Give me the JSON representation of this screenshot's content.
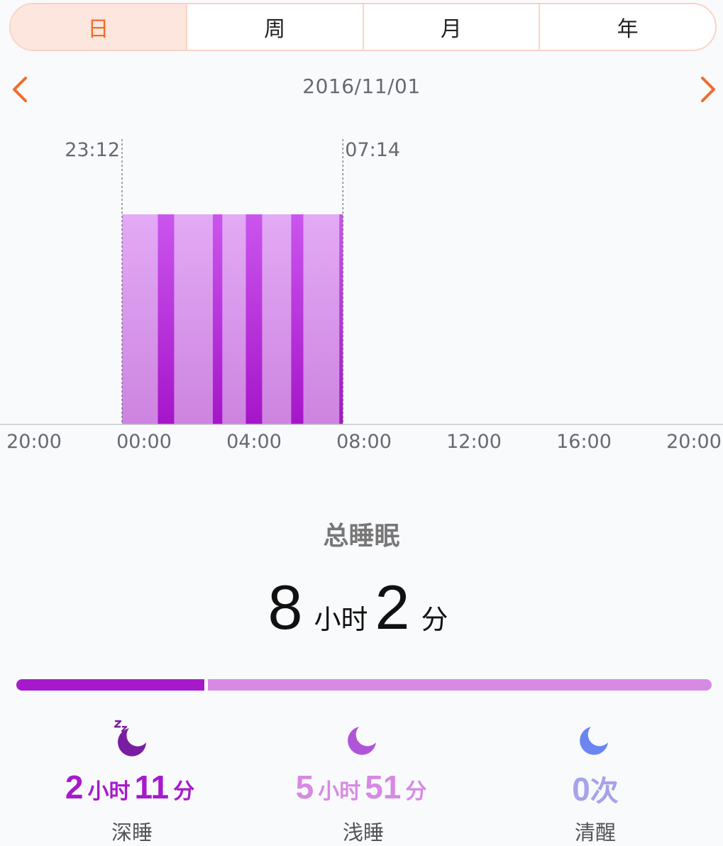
{
  "tabs": [
    "日",
    "周",
    "月",
    "年"
  ],
  "date": "2016/11/01",
  "chart_data": {
    "type": "bar",
    "x_ticks": [
      "20:00",
      "00:00",
      "04:00",
      "08:00",
      "12:00",
      "16:00",
      "20:00"
    ],
    "x_range_hours": [
      -4,
      20
    ],
    "sleep_start_label": "23:12",
    "sleep_end_label": "07:14",
    "sleep_start": -0.8,
    "sleep_end": 7.233,
    "segments": [
      {
        "stage": "light",
        "start": -0.8,
        "end": 0.5
      },
      {
        "stage": "deep",
        "start": 0.5,
        "end": 1.1
      },
      {
        "stage": "light",
        "start": 1.1,
        "end": 2.5
      },
      {
        "stage": "deep",
        "start": 2.5,
        "end": 2.85
      },
      {
        "stage": "light",
        "start": 2.85,
        "end": 3.7
      },
      {
        "stage": "deep",
        "start": 3.7,
        "end": 4.3
      },
      {
        "stage": "light",
        "start": 4.3,
        "end": 5.35
      },
      {
        "stage": "deep",
        "start": 5.35,
        "end": 5.8
      },
      {
        "stage": "light",
        "start": 5.8,
        "end": 7.1
      },
      {
        "stage": "deep",
        "start": 7.1,
        "end": 7.233
      }
    ],
    "colors": {
      "light_top": "#e3aaf5",
      "light_bottom": "#cd84e0",
      "deep_top": "#cb55ee",
      "deep_bottom": "#a515c8"
    }
  },
  "summary": {
    "title": "总睡眠",
    "hours": "8",
    "hours_unit": "小时",
    "minutes": "2",
    "minutes_unit": "分"
  },
  "ratio": {
    "deep_fraction": 0.272,
    "deep_color": "#a71acb",
    "light_color": "#d68ae3"
  },
  "stats": {
    "deep": {
      "hours": "2",
      "hours_unit": "小时",
      "minutes": "11",
      "minutes_unit": "分",
      "label": "深睡",
      "icon": "sleeping-moon-zzz-icon"
    },
    "light": {
      "hours": "5",
      "hours_unit": "小时",
      "minutes": "51",
      "minutes_unit": "分",
      "label": "浅睡",
      "icon": "sleeping-moon-icon"
    },
    "awake": {
      "count": "0",
      "count_unit": "次",
      "label": "清醒",
      "icon": "moon-icon"
    }
  }
}
